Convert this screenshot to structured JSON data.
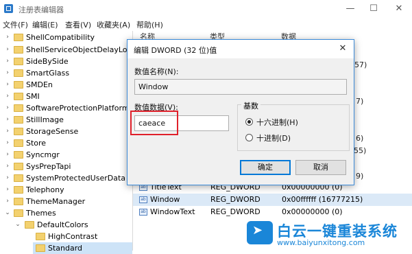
{
  "window": {
    "title": "注册表编辑器",
    "minimize": "—",
    "maximize": "☐",
    "close": "✕"
  },
  "menu": [
    "文件(F)",
    "编辑(E)",
    "查看(V)",
    "收藏夹(A)",
    "帮助(H)"
  ],
  "tree": {
    "items": [
      "ShellCompatibility",
      "ShellServiceObjectDelayLoad",
      "SideBySide",
      "SmartGlass",
      "SMDEn",
      "SMI",
      "SoftwareProtectionPlatform",
      "StillImage",
      "StorageSense",
      "Store",
      "Syncmgr",
      "SysPrepTapi",
      "SystemProtectedUserData",
      "Telephony",
      "ThemeManager",
      "Themes",
      "DefaultColors",
      "HighContrast",
      "Standard"
    ]
  },
  "list": {
    "headers": [
      "名称",
      "类型",
      "数据"
    ],
    "peek_values": [
      "57)",
      "7)",
      "6)",
      "55)",
      "9)"
    ],
    "rows": [
      {
        "name": "TitleText",
        "type": "REG_DWORD",
        "data": "0x00000000 (0)"
      },
      {
        "name": "Window",
        "type": "REG_DWORD",
        "data": "0x00ffffff (16777215)"
      },
      {
        "name": "WindowText",
        "type": "REG_DWORD",
        "data": "0x00000000 (0)"
      }
    ]
  },
  "dialog": {
    "title": "编辑 DWORD (32 位)值",
    "value_name_label": "数值名称(N):",
    "value_name": "Window",
    "value_data_label": "数值数据(V):",
    "value_data": "caeace",
    "base_label": "基数",
    "radix_hex": "十六进制(H)",
    "radix_dec": "十进制(D)",
    "ok": "确定",
    "cancel": "取消",
    "close": "✕"
  },
  "watermark": {
    "title": "白云一键重装系统",
    "url": "www.baiyunxitong.com"
  }
}
